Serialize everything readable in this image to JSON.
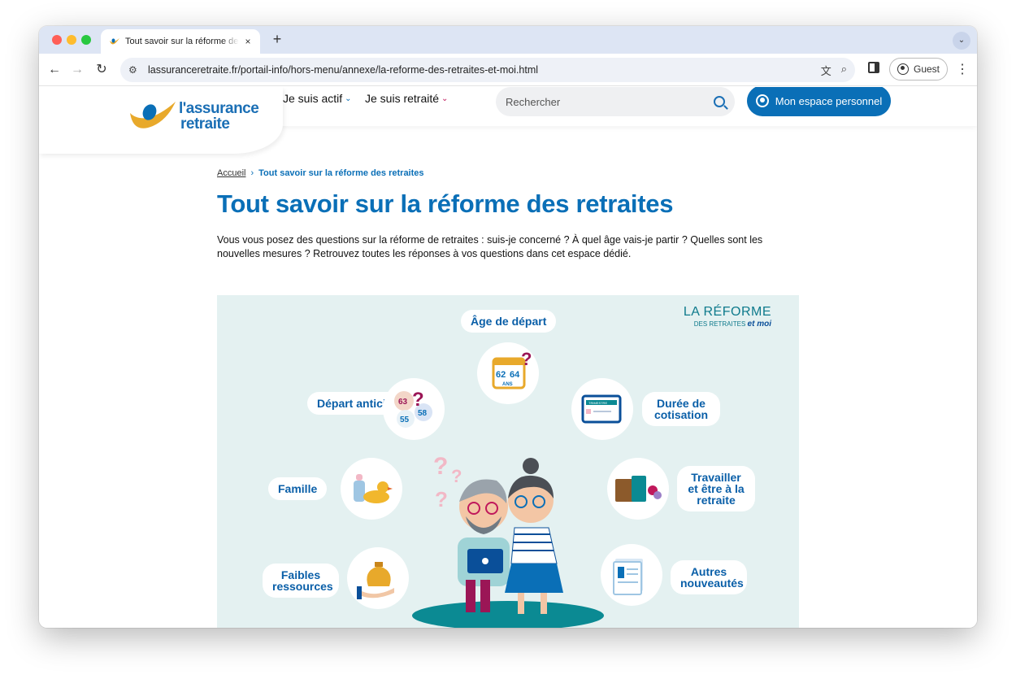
{
  "browser": {
    "tab_title": "Tout savoir sur la réforme des retraites",
    "new_tab": "+",
    "tab_close": "×",
    "url": "lassuranceretraite.fr/portail-info/hors-menu/annexe/la-reforme-des-retraites-et-moi.html",
    "profile_label": "Guest"
  },
  "site": {
    "logo": {
      "line1": "l'assurance",
      "line2": "retraite"
    },
    "menu": [
      {
        "label": "Je suis actif",
        "chevron_color": "#0a6fb7"
      },
      {
        "label": "Je suis retraité",
        "chevron_color": "#c0185b"
      }
    ],
    "search_placeholder": "Rechercher",
    "account_button": "Mon espace personnel"
  },
  "breadcrumb": {
    "home": "Accueil",
    "separator": "›",
    "current": "Tout savoir sur la réforme des retraites"
  },
  "page_title": "Tout savoir sur la réforme des retraites",
  "intro": "Vous vous posez des questions sur la réforme de retraites : suis-je concerné ? À quel âge vais-je partir ? Quelles sont les nouvelles mesures ? Retrouvez toutes les réponses à vos questions dans cet espace dédié.",
  "hero": {
    "brand": {
      "line1": "LA RÉFORME",
      "line2": "DES RETRAITES",
      "line3": "et moi"
    },
    "topics": {
      "age": "Âge de départ",
      "anticipe": "Départ anticipé",
      "duree": "Durée de cotisation",
      "famille": "Famille",
      "travailler": "Travailler et être à la retraite",
      "faibles": "Faibles ressources",
      "autres": "Autres nouveautés"
    },
    "calendar": {
      "a": "62",
      "b": "64",
      "unit": "ANS"
    },
    "ages": {
      "a": "63",
      "b": "58",
      "c": "55",
      "unit": "ANS"
    },
    "card_label": "TRIMESTRE",
    "colors": {
      "primary": "#0a6fb7",
      "accent": "#e8a92b",
      "magenta": "#9b1656",
      "teal": "#0b8a93"
    }
  }
}
